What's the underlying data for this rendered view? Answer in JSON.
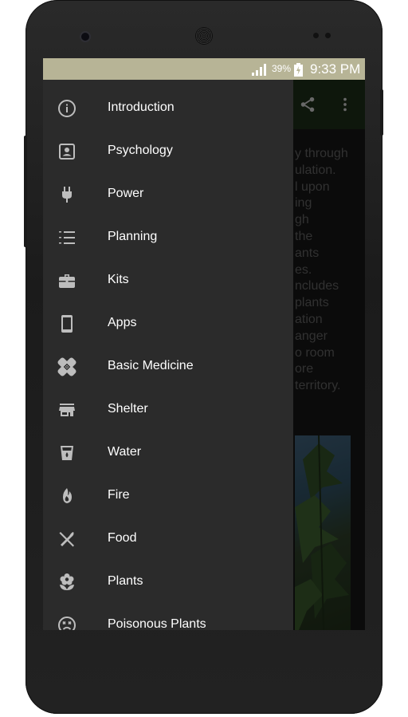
{
  "status_bar": {
    "battery_percent": "39%",
    "time": "9:33 PM"
  },
  "app_bar": {
    "share_icon": "share-icon",
    "overflow_icon": "more-vert-icon"
  },
  "content": {
    "text_lines": [
      "y through",
      "ulation.",
      "l upon",
      "ing",
      "gh",
      "the",
      "ants",
      "es.",
      "ncludes",
      "plants",
      "ation",
      "anger",
      "o room",
      "ore",
      "territory."
    ]
  },
  "drawer": {
    "items": [
      {
        "label": "Introduction",
        "icon": "info-icon"
      },
      {
        "label": "Psychology",
        "icon": "contact-icon"
      },
      {
        "label": "Power",
        "icon": "plug-icon"
      },
      {
        "label": "Planning",
        "icon": "numbered-list-icon"
      },
      {
        "label": "Kits",
        "icon": "briefcase-icon"
      },
      {
        "label": "Apps",
        "icon": "smartphone-icon"
      },
      {
        "label": "Basic Medicine",
        "icon": "bandage-icon"
      },
      {
        "label": "Shelter",
        "icon": "store-icon"
      },
      {
        "label": "Water",
        "icon": "water-glass-icon"
      },
      {
        "label": "Fire",
        "icon": "fire-icon"
      },
      {
        "label": "Food",
        "icon": "utensils-icon"
      },
      {
        "label": "Plants",
        "icon": "flower-icon"
      },
      {
        "label": "Poisonous Plants",
        "icon": "sick-face-icon"
      }
    ]
  },
  "colors": {
    "status_bar": "#b7b496",
    "app_bar": "#1b2a16",
    "drawer": "#2b2b2b",
    "icon": "#bdbdbd"
  }
}
